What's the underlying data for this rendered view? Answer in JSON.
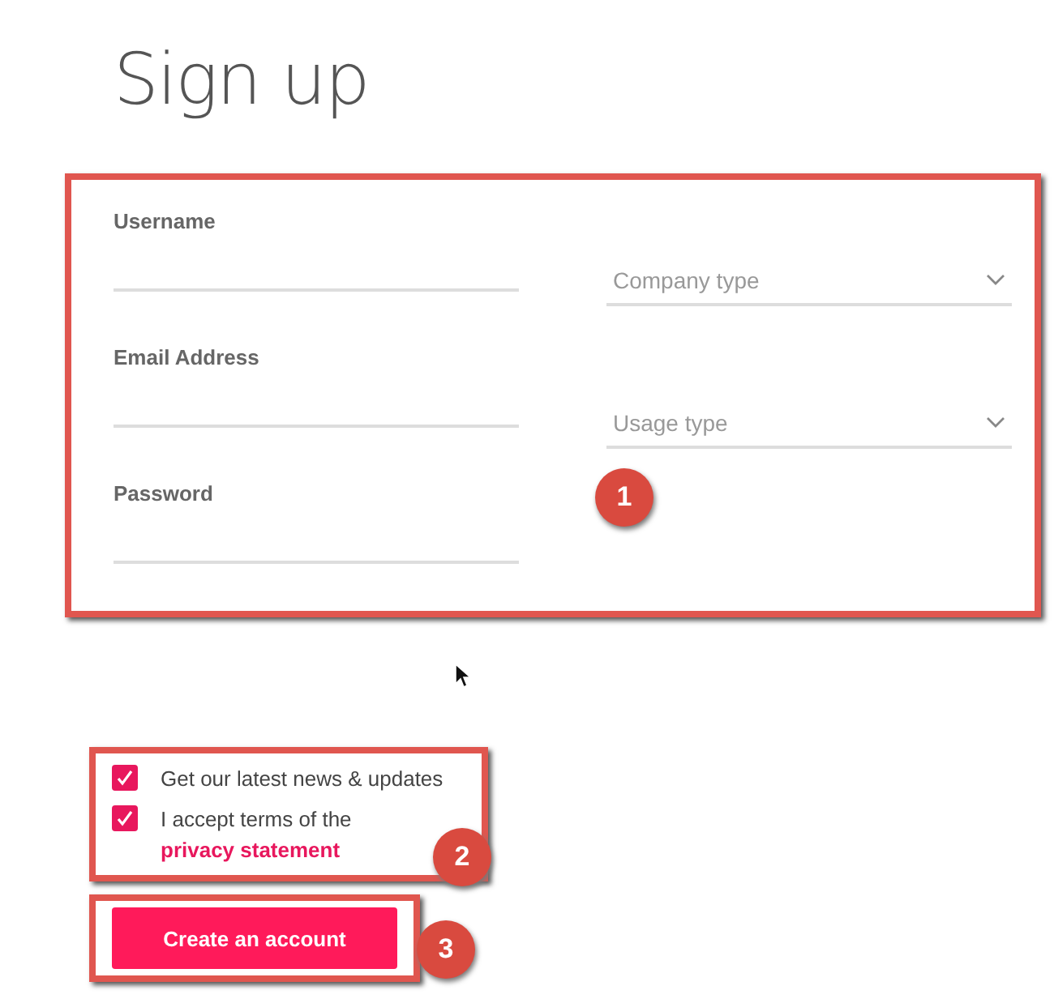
{
  "title": "Sign up",
  "form": {
    "fields": [
      {
        "label": "Username"
      },
      {
        "label": "Email Address"
      },
      {
        "label": "Password"
      }
    ],
    "selects": [
      {
        "placeholder": "Company type"
      },
      {
        "placeholder": "Usage type"
      }
    ]
  },
  "checkboxes": [
    {
      "kind": "plain",
      "label": "Get our latest news & updates",
      "checked": true
    },
    {
      "kind": "link",
      "label": "I accept terms of the",
      "link": "privacy statement",
      "checked": true
    }
  ],
  "button": "Create an account",
  "callouts": [
    "1",
    "2",
    "3"
  ]
}
